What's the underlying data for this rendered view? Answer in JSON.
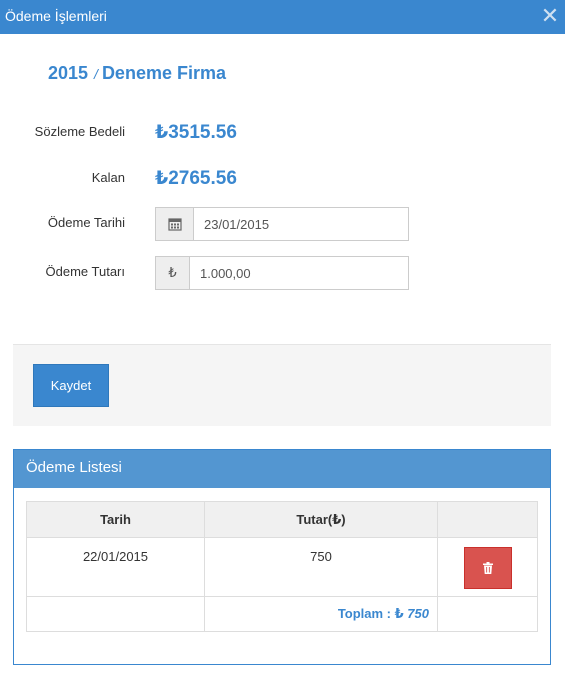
{
  "window": {
    "title": "Ödeme İşlemleri",
    "close_glyph": "✕"
  },
  "heading": {
    "year": "2015",
    "separator": "/",
    "company": "Deneme Firma"
  },
  "summary": {
    "contract_label": "Sözleme Bedeli",
    "contract_value": "₺3515.56",
    "remaining_label": "Kalan",
    "remaining_value": "₺2765.56"
  },
  "form": {
    "date_label": "Ödeme Tarihi",
    "date_icon": "calendar-icon",
    "date_value": "23/01/2015",
    "amount_label": "Ödeme Tutarı",
    "amount_icon_glyph": "₺",
    "amount_value": "1.000,00"
  },
  "actions": {
    "save_label": "Kaydet"
  },
  "payment_list": {
    "title": "Ödeme Listesi",
    "columns": [
      "Tarih",
      "Tutar(₺)",
      ""
    ],
    "rows": [
      {
        "date": "22/01/2015",
        "amount": "750",
        "action_icon": "trash-icon"
      }
    ],
    "total_label": "Toplam : ₺",
    "total_value": "750"
  },
  "colors": {
    "accent": "#3a87cf",
    "panel_header": "#5396d1",
    "danger": "#d9534f"
  }
}
